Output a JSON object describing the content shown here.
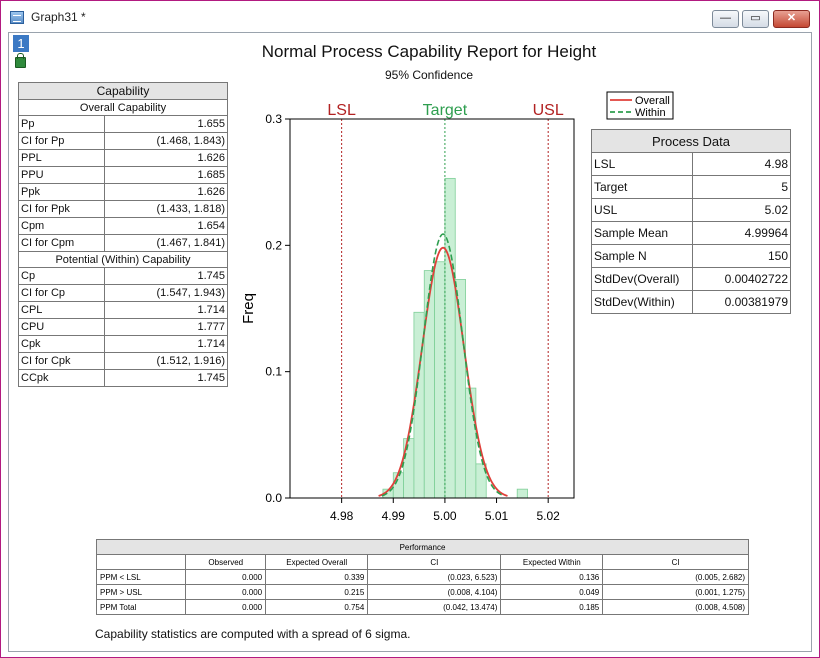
{
  "window": {
    "title": "Graph31 *",
    "layer_label": "1",
    "min_glyph": "—",
    "max_glyph": "▭",
    "close_glyph": "✕"
  },
  "report": {
    "title": "Normal Process Capability Report for Height",
    "subtitle": "95% Confidence"
  },
  "capability": {
    "header": "Capability",
    "overall_header": "Overall Capability",
    "overall_rows": [
      {
        "label": "Pp",
        "value": "1.655"
      },
      {
        "label": "CI for Pp",
        "value": "(1.468, 1.843)"
      },
      {
        "label": "PPL",
        "value": "1.626"
      },
      {
        "label": "PPU",
        "value": "1.685"
      },
      {
        "label": "Ppk",
        "value": "1.626"
      },
      {
        "label": "CI for Ppk",
        "value": "(1.433, 1.818)"
      },
      {
        "label": "Cpm",
        "value": "1.654"
      },
      {
        "label": "CI for Cpm",
        "value": "(1.467, 1.841)"
      }
    ],
    "within_header": "Potential (Within) Capability",
    "within_rows": [
      {
        "label": "Cp",
        "value": "1.745"
      },
      {
        "label": "CI for Cp",
        "value": "(1.547, 1.943)"
      },
      {
        "label": "CPL",
        "value": "1.714"
      },
      {
        "label": "CPU",
        "value": "1.777"
      },
      {
        "label": "Cpk",
        "value": "1.714"
      },
      {
        "label": "CI for Cpk",
        "value": "(1.512, 1.916)"
      },
      {
        "label": "CCpk",
        "value": "1.745"
      }
    ]
  },
  "process": {
    "header": "Process Data",
    "rows": [
      {
        "label": "LSL",
        "value": "4.98"
      },
      {
        "label": "Target",
        "value": "5"
      },
      {
        "label": "USL",
        "value": "5.02"
      },
      {
        "label": "Sample Mean",
        "value": "4.99964"
      },
      {
        "label": "Sample N",
        "value": "150"
      },
      {
        "label": "StdDev(Overall)",
        "value": "0.00402722"
      },
      {
        "label": "StdDev(Within)",
        "value": "0.00381979"
      }
    ]
  },
  "performance": {
    "header": "Performance",
    "columns": [
      "",
      "Observed",
      "Expected Overall",
      "CI",
      "Expected Within",
      "CI"
    ],
    "rows": [
      [
        "PPM < LSL",
        "0.000",
        "0.339",
        "(0.023, 6.523)",
        "0.136",
        "(0.005, 2.682)"
      ],
      [
        "PPM > USL",
        "0.000",
        "0.215",
        "(0.008, 4.104)",
        "0.049",
        "(0.001, 1.275)"
      ],
      [
        "PPM Total",
        "0.000",
        "0.754",
        "(0.042, 13.474)",
        "0.185",
        "(0.008, 4.508)"
      ]
    ]
  },
  "footnote": "Capability statistics are computed with a spread of 6 sigma.",
  "chart_data": {
    "type": "bar",
    "ylabel": "Freq",
    "xlim": [
      4.97,
      5.025
    ],
    "ylim": [
      0,
      0.3
    ],
    "xticks": [
      "4.98",
      "4.99",
      "5.00",
      "5.01",
      "5.02"
    ],
    "xtick_values": [
      4.98,
      4.99,
      5.0,
      5.01,
      5.02
    ],
    "yticks": [
      "0.0",
      "0.1",
      "0.2",
      "0.3"
    ],
    "ytick_values": [
      0,
      0.1,
      0.2,
      0.3
    ],
    "bin_width": 0.002,
    "bins": [
      {
        "x0": 4.988,
        "value": 0.007
      },
      {
        "x0": 4.99,
        "value": 0.02
      },
      {
        "x0": 4.992,
        "value": 0.047
      },
      {
        "x0": 4.994,
        "value": 0.147
      },
      {
        "x0": 4.996,
        "value": 0.18
      },
      {
        "x0": 4.998,
        "value": 0.187
      },
      {
        "x0": 5.0,
        "value": 0.253
      },
      {
        "x0": 5.002,
        "value": 0.173
      },
      {
        "x0": 5.004,
        "value": 0.087
      },
      {
        "x0": 5.006,
        "value": 0.027
      },
      {
        "x0": 5.008,
        "value": 0.0
      },
      {
        "x0": 5.01,
        "value": 0.0
      },
      {
        "x0": 5.014,
        "value": 0.007
      }
    ],
    "spec_lines": [
      {
        "name": "LSL",
        "x": 4.98,
        "color": "#b22222"
      },
      {
        "name": "Target",
        "x": 5.0,
        "color": "#2e9e4f"
      },
      {
        "name": "USL",
        "x": 5.02,
        "color": "#b22222"
      }
    ],
    "series": [
      {
        "name": "Overall",
        "mean": 4.99964,
        "sd": 0.00402722,
        "color": "#e0403a",
        "style": "solid"
      },
      {
        "name": "Within",
        "mean": 4.99964,
        "sd": 0.00381979,
        "color": "#2e9e4f",
        "style": "dashed"
      }
    ],
    "bar_color": "#c9efd5",
    "bar_stroke": "#7fcf98",
    "legend_position": "top-right"
  }
}
